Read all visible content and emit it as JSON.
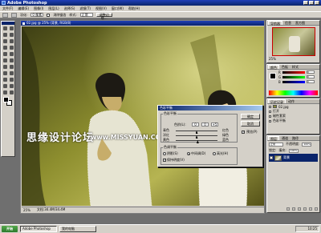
{
  "app": {
    "title": "Adobe Photoshop"
  },
  "menu": [
    "文件(F)",
    "编辑(E)",
    "图像(I)",
    "图层(L)",
    "选择(S)",
    "滤镜(T)",
    "视图(V)",
    "窗口(W)",
    "帮助(H)"
  ],
  "options": {
    "feather_label": "羽化:",
    "feather_value": "0 像素",
    "antialias_label": "消除锯齿",
    "style_label": "样式:",
    "style_value": "正常",
    "refine_label": "调整边缘..."
  },
  "document": {
    "title": "02.jpg @ 25% (背景, RGB/8)",
    "zoom": "25%",
    "docsize": "文档:34.4M/34.4M"
  },
  "dialog": {
    "title": "色彩平衡",
    "balance_group": "色彩平衡",
    "levels_label": "色阶(L):",
    "levels": [
      "0",
      "0",
      "+5"
    ],
    "sliders": [
      {
        "left": "青色",
        "right": "红色",
        "value": 0
      },
      {
        "left": "洋红",
        "right": "绿色",
        "value": 0
      },
      {
        "left": "黄色",
        "right": "蓝色",
        "value": 5
      }
    ],
    "tone_group": "色调平衡",
    "tones": [
      "阴影(S)",
      "中间调(D)",
      "高光(H)"
    ],
    "tone_selected": 1,
    "preserve_luminosity": "保持明度(V)",
    "ok": "确定",
    "cancel": "取消",
    "preview": "预览(P)"
  },
  "navigator": {
    "tabs": [
      "导航器",
      "信息",
      "直方图"
    ],
    "zoom": "25%"
  },
  "color_panel": {
    "tabs": [
      "颜色",
      "色板",
      "样式"
    ],
    "channels": [
      {
        "name": "R",
        "value": "0"
      },
      {
        "name": "G",
        "value": "0"
      },
      {
        "name": "B",
        "value": "0"
      }
    ]
  },
  "history_panel": {
    "tabs": [
      "历史记录",
      "动作"
    ],
    "snapshot": "02.jpg",
    "steps": [
      "打开",
      "磁性套索",
      "色彩平衡"
    ]
  },
  "layers_panel": {
    "tabs": [
      "图层",
      "通道",
      "路径"
    ],
    "mode": "正常",
    "opacity_label": "不透明度:",
    "opacity": "100%",
    "lock_label": "锁定:",
    "fill_label": "填充:",
    "fill": "100%",
    "layers": [
      {
        "name": "背景"
      }
    ]
  },
  "taskbar": {
    "start": "开始",
    "tasks": [
      "Adobe Photoshop",
      "我的电脑"
    ],
    "clock": "10:25"
  },
  "watermark": {
    "cn": "思缘设计论坛",
    "en": "www.MISSYUAN.COM"
  },
  "colors": {
    "titlebar": "#0a246a",
    "chrome": "#d4d0c8"
  }
}
